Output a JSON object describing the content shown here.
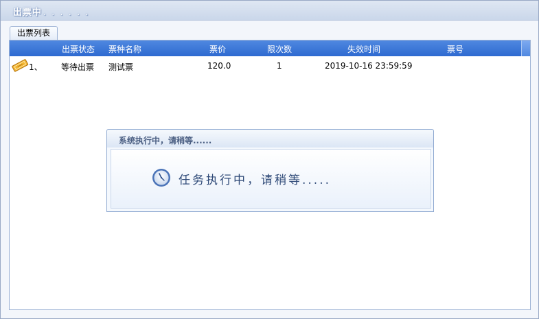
{
  "window": {
    "title": "出票中",
    "title_dots": ". . . . . ."
  },
  "tabs": [
    {
      "label": "出票列表",
      "active": true
    }
  ],
  "grid": {
    "columns": [
      "出票状态",
      "票种名称",
      "票价",
      "限次数",
      "失效时间",
      "票号"
    ],
    "rows": [
      {
        "index": "1、",
        "icon": "ticket-icon",
        "status": "等待出票",
        "name": "测试票",
        "price": "120.0",
        "limit": "1",
        "expiry": "2019-10-16 23:59:59",
        "ticket_no": ""
      }
    ]
  },
  "dialog": {
    "title": "系统执行中，请稍等......",
    "message": "任务执行中，请稍等.....",
    "icon": "clock-icon"
  },
  "colors": {
    "header_blue": "#3f7ad8",
    "dialog_text": "#2f4a78"
  }
}
